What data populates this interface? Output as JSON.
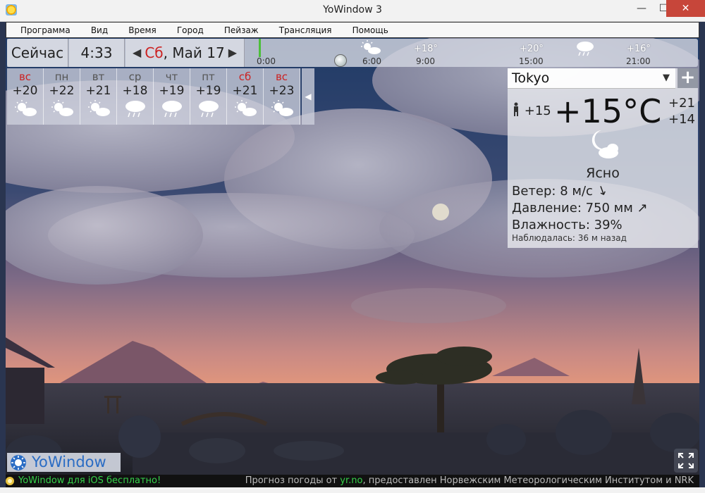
{
  "window": {
    "title": "YoWindow 3",
    "minimize": "—",
    "maximize": "☐",
    "close": "✕"
  },
  "menu": [
    "Программа",
    "Вид",
    "Время",
    "Город",
    "Пейзаж",
    "Трансляция",
    "Помощь"
  ],
  "topbar": {
    "now_label": "Сейчас",
    "time": "4:33",
    "date_day": "Сб",
    "date_rest": ", Май 17",
    "timeline_labels": [
      "0:00",
      "6:00",
      "9:00",
      "15:00",
      "21:00"
    ],
    "timeline_temps": [
      "+18°",
      "+20°",
      "+16°"
    ]
  },
  "forecast": [
    {
      "day": "вс",
      "temp": "+20",
      "weekend": true,
      "icon": "sun-cloud-icon"
    },
    {
      "day": "пн",
      "temp": "+22",
      "weekend": false,
      "icon": "sun-cloud-icon"
    },
    {
      "day": "вт",
      "temp": "+21",
      "weekend": false,
      "icon": "sun-cloud-icon"
    },
    {
      "day": "ср",
      "temp": "+18",
      "weekend": false,
      "icon": "rain-cloud-icon"
    },
    {
      "day": "чт",
      "temp": "+19",
      "weekend": false,
      "icon": "rain-cloud-icon"
    },
    {
      "day": "пт",
      "temp": "+19",
      "weekend": false,
      "icon": "rain-cloud-icon"
    },
    {
      "day": "сб",
      "temp": "+21",
      "weekend": true,
      "icon": "sun-cloud-icon"
    },
    {
      "day": "вс",
      "temp": "+23",
      "weekend": true,
      "icon": "sun-cloud-icon"
    }
  ],
  "current": {
    "city": "Tokyo",
    "temp": "+15°C",
    "feels": "+15",
    "high": "+21",
    "low": "+14",
    "condition": "Ясно",
    "wind": "Ветер:  8 м/с",
    "pressure": "Давление:  750 мм",
    "humidity": "Влажность:  39%",
    "observed": "Наблюдалась:  36 м назад"
  },
  "brand": "YoWindow",
  "status": {
    "left": "YoWindow для iOS бесплатно!",
    "right_prefix": "Прогноз погоды от ",
    "right_link": "yr.no",
    "right_suffix": ", предоставлен Норвежским Метеорологическим Институтом и NRK"
  },
  "colors": {
    "weekend": "#cc2222",
    "accent": "#2a6cc4",
    "status_link": "#35d24a"
  }
}
